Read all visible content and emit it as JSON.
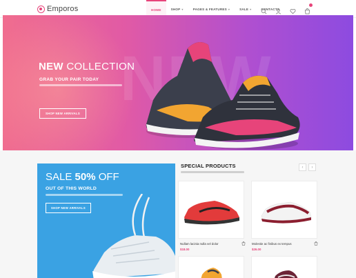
{
  "brand": {
    "name": "Emporos",
    "accent": "#e7447a"
  },
  "nav": {
    "items": [
      {
        "label": "HOME",
        "active": true
      },
      {
        "label": "SHOP",
        "caret": "▾"
      },
      {
        "label": "PAGES & FEATURES",
        "caret": "▾"
      },
      {
        "label": "SALE",
        "caret": "▾"
      },
      {
        "label": "CONTACTS"
      }
    ],
    "icons": [
      "search-icon",
      "user-icon",
      "heart-icon",
      "cart-icon"
    ]
  },
  "hero": {
    "title_bold": "NEW",
    "title_rest": " COLLECTION",
    "subtitle": "GRAB YOUR PAIR TODAY",
    "button": "SHOP NEW ARRIVALS",
    "background_word": "NEW"
  },
  "promo": {
    "title_prefix": "SALE ",
    "title_bold": "50%",
    "title_suffix": " OFF",
    "subtitle": "OUT OF THIS WORLD",
    "button": "SHOP NEW ARRIVALS",
    "color": "#3aa2e3"
  },
  "special": {
    "title": "SPECIAL PRODUCTS",
    "prev": "‹",
    "next": "›",
    "products": [
      {
        "name": "Nullam lacinia nulla vel dolor",
        "price": "$18.00"
      },
      {
        "name": "Molestie ac finibus ex tempus",
        "price": "$26.00"
      }
    ]
  }
}
